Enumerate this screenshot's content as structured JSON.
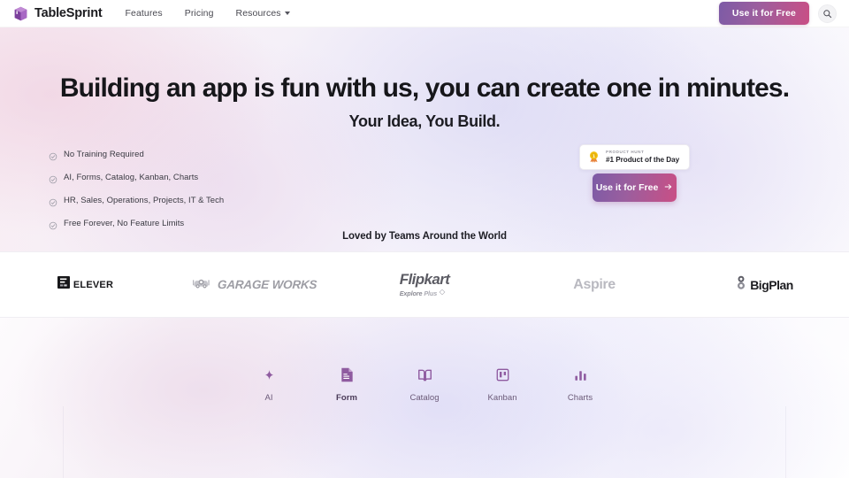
{
  "brand": {
    "name": "TableSprint",
    "logo_icon": "cube-logo-icon",
    "color": "#8a4fa8"
  },
  "nav": {
    "links": [
      {
        "label": "Features",
        "icon": null
      },
      {
        "label": "Pricing",
        "icon": null
      },
      {
        "label": "Resources",
        "icon": "chevron-down-icon"
      }
    ],
    "cta_label": "Use it for Free",
    "search_icon": "search-icon"
  },
  "hero": {
    "headline": "Building an app is fun with us, you can create one in minutes.",
    "subheadline": "Your Idea, You Build.",
    "checklist": [
      {
        "label": "No Training Required",
        "icon": "check-circle-icon"
      },
      {
        "label": "AI, Forms, Catalog, Kanban, Charts",
        "icon": "check-circle-icon"
      },
      {
        "label": "HR, Sales, Operations, Projects, IT & Tech",
        "icon": "check-circle-icon"
      },
      {
        "label": "Free Forever, No Feature Limits",
        "icon": "check-circle-icon"
      }
    ],
    "product_hunt": {
      "kicker": "PRODUCT HUNT",
      "title": "#1 Product of the Day",
      "icon": "product-hunt-medal-icon",
      "medal_color": "#f0c419"
    },
    "cta": {
      "label": "Use it for Free",
      "icon": "arrow-right-icon"
    },
    "gradient_colors": {
      "pink": "#f8eef4",
      "lavender": "#f1f0fb",
      "accent_start": "#7d5ba6",
      "accent_end": "#c94f85"
    }
  },
  "social_proof": {
    "heading": "Loved by Teams Around the World",
    "logos": [
      {
        "name": "Elever",
        "label": "ELEVER",
        "icon": "elever-mark-icon"
      },
      {
        "name": "Garage Works",
        "label": "GARAGE WORKS",
        "icon": "garage-car-icon"
      },
      {
        "name": "Flipkart",
        "label": "Flipkart",
        "tagline_1": "Explore",
        "tagline_2": "Plus",
        "icon": "flipkart-plus-icon"
      },
      {
        "name": "Aspire",
        "label": "Aspire",
        "icon": null
      },
      {
        "name": "BigPlan",
        "label": "BigPlan",
        "icon": "bigplan-mark-icon"
      }
    ]
  },
  "features": {
    "items": [
      {
        "label": "AI",
        "icon": "sparkle-icon",
        "active": false
      },
      {
        "label": "Form",
        "icon": "document-form-icon",
        "active": true
      },
      {
        "label": "Catalog",
        "icon": "open-book-icon",
        "active": false
      },
      {
        "label": "Kanban",
        "icon": "kanban-board-icon",
        "active": false
      },
      {
        "label": "Charts",
        "icon": "bar-chart-icon",
        "active": false
      }
    ],
    "accent_color": "#8f5ba0"
  }
}
